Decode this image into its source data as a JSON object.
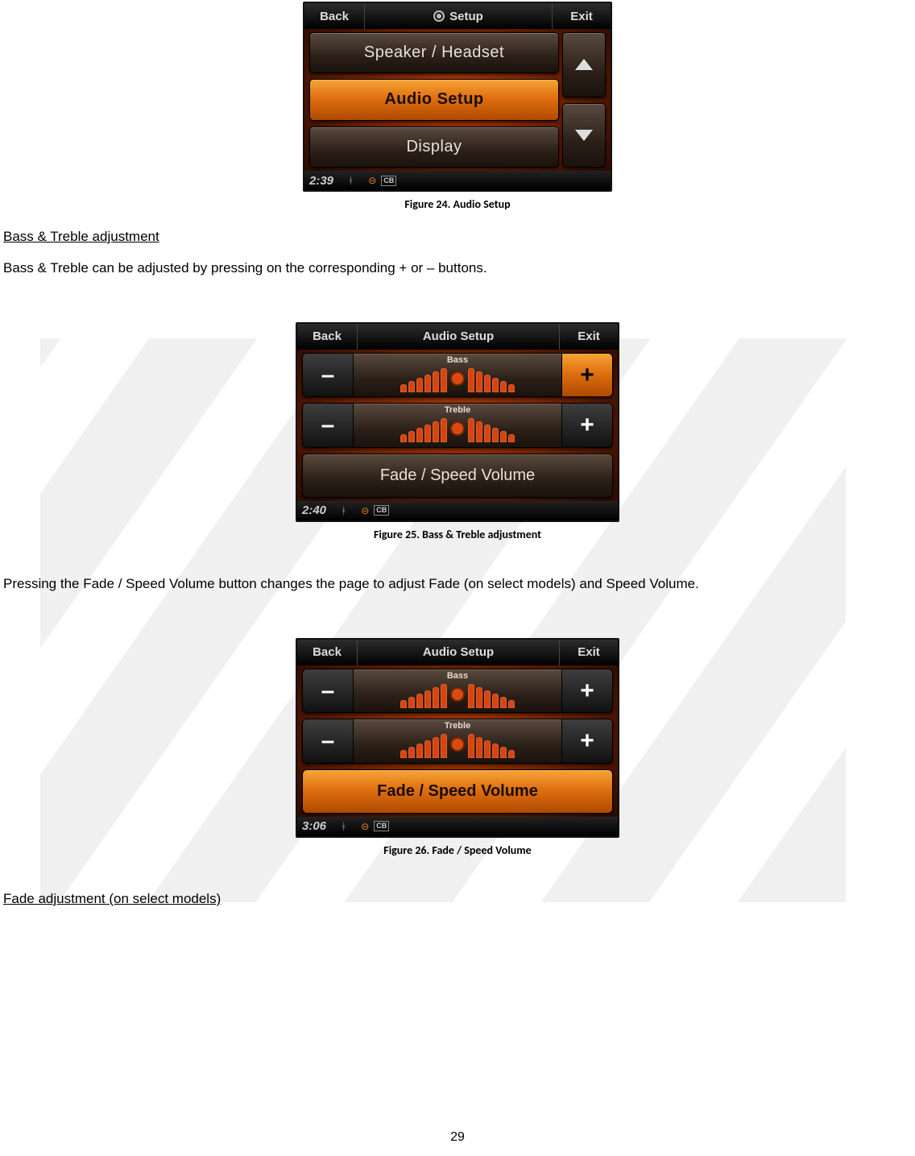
{
  "page_number": "29",
  "headings": {
    "bass_treble": "Bass & Treble adjustment",
    "fade": "Fade adjustment (on select models)"
  },
  "paragraphs": {
    "bass_treble": "Bass & Treble can be adjusted by pressing on the corresponding + or – buttons.",
    "fade_speed": "Pressing the Fade / Speed Volume button changes the page to adjust Fade (on select models) and Speed Volume."
  },
  "captions": {
    "fig24": "Figure 24. Audio Setup",
    "fig25": "Figure 25. Bass & Treble adjustment",
    "fig26": "Figure 26. Fade / Speed Volume"
  },
  "screens": {
    "a": {
      "back": "Back",
      "title": "Setup",
      "exit": "Exit",
      "items": [
        "Speaker / Headset",
        "Audio Setup",
        "Display"
      ],
      "active_index": 1,
      "clock": "2:39",
      "status_cb": "CB"
    },
    "b": {
      "back": "Back",
      "title": "Audio Setup",
      "exit": "Exit",
      "row_bass_label": "Bass",
      "row_treble_label": "Treble",
      "fsv_label": "Fade / Speed Volume",
      "fsv_active": false,
      "bass_plus_active": true,
      "clock": "2:40",
      "status_cb": "CB"
    },
    "c": {
      "back": "Back",
      "title": "Audio Setup",
      "exit": "Exit",
      "row_bass_label": "Bass",
      "row_treble_label": "Treble",
      "fsv_label": "Fade / Speed Volume",
      "fsv_active": true,
      "bass_plus_active": false,
      "clock": "3:06",
      "status_cb": "CB"
    }
  },
  "glyphs": {
    "minus": "–",
    "plus": "+"
  }
}
